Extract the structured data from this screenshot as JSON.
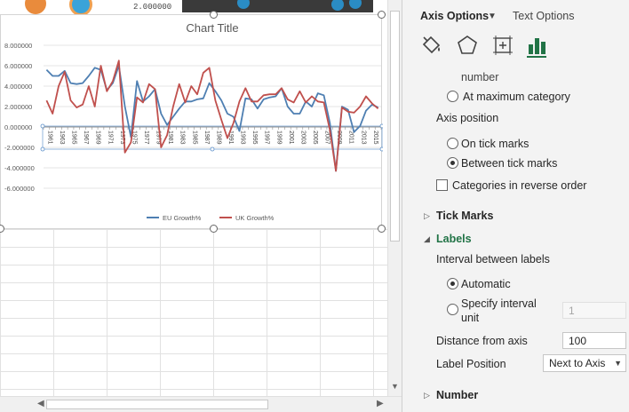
{
  "sheet": {
    "top_label": "2.000000"
  },
  "chart_data": {
    "type": "line",
    "title": "Chart Title",
    "xlabel": "",
    "ylabel": "",
    "ylim": [
      -8,
      8
    ],
    "y_ticks": [
      "8.000000",
      "6.000000",
      "4.000000",
      "2.000000",
      "0.000000",
      "-2.000000",
      "-4.000000",
      "-6.000000"
    ],
    "y_tick_values": [
      8,
      6,
      4,
      2,
      0,
      -2,
      -4,
      -6
    ],
    "x_tick_labels": [
      "1961",
      "1963",
      "1965",
      "1967",
      "1969",
      "1971",
      "1973",
      "1975",
      "1977",
      "1979",
      "1981",
      "1983",
      "1985",
      "1987",
      "1989",
      "1991",
      "1993",
      "1995",
      "1997",
      "1999",
      "2001",
      "2003",
      "2005",
      "2007",
      "2009",
      "2011",
      "2013",
      "2015"
    ],
    "x": [
      1961,
      1962,
      1963,
      1964,
      1965,
      1966,
      1967,
      1968,
      1969,
      1970,
      1971,
      1972,
      1973,
      1974,
      1975,
      1976,
      1977,
      1978,
      1979,
      1980,
      1981,
      1982,
      1983,
      1984,
      1985,
      1986,
      1987,
      1988,
      1989,
      1990,
      1991,
      1992,
      1993,
      1994,
      1995,
      1996,
      1997,
      1998,
      1999,
      2000,
      2001,
      2002,
      2003,
      2004,
      2005,
      2006,
      2007,
      2008,
      2009,
      2010,
      2011,
      2012,
      2013,
      2014,
      2015,
      2016
    ],
    "legend_position": "bottom",
    "series": [
      {
        "name": "EU Growth%",
        "color": "#4e7fb2",
        "values": [
          5.6,
          5.0,
          5.0,
          5.5,
          4.3,
          4.2,
          4.3,
          5.0,
          5.8,
          5.6,
          3.6,
          4.3,
          6.0,
          2.0,
          -1.0,
          4.5,
          2.5,
          3.0,
          3.7,
          1.3,
          0.2,
          1.0,
          1.8,
          2.5,
          2.5,
          2.7,
          2.8,
          4.3,
          3.5,
          2.6,
          1.3,
          1.0,
          -0.4,
          2.8,
          2.7,
          1.8,
          2.7,
          2.9,
          3.0,
          3.8,
          2.0,
          1.3,
          1.3,
          2.5,
          2.0,
          3.3,
          3.1,
          0.4,
          -4.3,
          2.0,
          1.7,
          -0.5,
          0.1,
          1.6,
          2.2,
          1.9
        ]
      },
      {
        "name": "UK Growth%",
        "color": "#c0504d",
        "values": [
          2.6,
          1.3,
          4.0,
          5.4,
          2.6,
          1.9,
          2.2,
          4.0,
          2.0,
          6.0,
          3.5,
          4.5,
          6.5,
          -2.5,
          -1.5,
          2.9,
          2.4,
          4.2,
          3.7,
          -2.0,
          -0.8,
          2.0,
          4.2,
          2.4,
          4.0,
          3.2,
          5.3,
          5.8,
          2.6,
          0.7,
          -1.1,
          0.4,
          2.5,
          3.8,
          2.5,
          2.5,
          3.1,
          3.2,
          3.2,
          3.8,
          2.7,
          2.4,
          3.5,
          2.4,
          3.0,
          2.5,
          2.4,
          -0.3,
          -4.3,
          1.9,
          1.5,
          1.4,
          2.0,
          3.0,
          2.3,
          1.8
        ]
      }
    ]
  },
  "pane": {
    "tabs": {
      "axis_options": "Axis Options",
      "text_options": "Text Options"
    },
    "icons": {
      "fill_line": "paint-bucket-icon",
      "effects": "pentagon-icon",
      "size_properties": "size-properties-icon",
      "axis_options": "bar-chart-icon"
    },
    "cut_text": "number",
    "at_max_category": "At maximum category",
    "axis_position": {
      "heading": "Axis position",
      "on_tick_marks": "On tick marks",
      "between_tick_marks": "Between tick marks",
      "selected": "between_tick_marks"
    },
    "reverse_order": "Categories in reverse order",
    "tick_marks": "Tick Marks",
    "labels": {
      "title": "Labels",
      "interval_heading": "Interval between labels",
      "automatic": "Automatic",
      "specify_interval": "Specify interval",
      "specify_interval_line2": "unit",
      "interval_value": "1",
      "distance_label": "Distance from axis",
      "distance_value": "100",
      "label_position_label": "Label Position",
      "label_position_value": "Next to Axis"
    },
    "number": "Number"
  }
}
